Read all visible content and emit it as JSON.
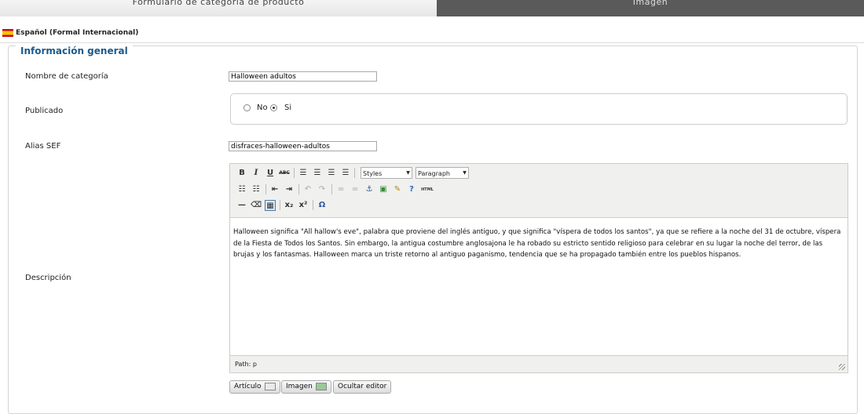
{
  "tabs": [
    {
      "label": "Formulario de categoría de producto",
      "active": true
    },
    {
      "label": "Imagen",
      "active": false
    }
  ],
  "language": {
    "label": "Español (Formal Internacional)",
    "flag": "spain-flag-icon"
  },
  "section": {
    "legend": "Información general"
  },
  "fields": {
    "name": {
      "label": "Nombre de categoría",
      "value": "Halloween adultos"
    },
    "published": {
      "label": "Publicado",
      "options": [
        "No",
        "Si"
      ],
      "selected": "Si"
    },
    "alias": {
      "label": "Alias SEF",
      "value": "disfraces-halloween-adultos"
    },
    "description": {
      "label": "Descripción"
    }
  },
  "editor": {
    "styles_select": "Styles",
    "format_select": "Paragraph",
    "content": "Halloween significa \"All hallow's eve\", palabra que proviene del inglés antiguo, y que significa \"víspera de todos los santos\", ya que se refiere a la noche del 31 de octubre, víspera de la Fiesta de Todos los Santos. Sin embargo, la antigua costumbre anglosajona le ha robado su estricto sentido religioso para celebrar en su lugar la noche del terror, de las brujas y los fantasmas. Halloween marca un triste retorno al antiguo paganismo, tendencia que se ha propagado también entre los pueblos hispanos.",
    "path": "Path: p",
    "toolbar_glyphs": {
      "bold": "B",
      "italic": "I",
      "underline": "U",
      "strikethrough": "ABC",
      "subscript": "x₂",
      "superscript": "x²",
      "special_char": "Ω",
      "html": "HTML"
    }
  },
  "buttons": {
    "article": "Artículo",
    "image": "Imagen",
    "hide_editor": "Ocultar editor"
  }
}
